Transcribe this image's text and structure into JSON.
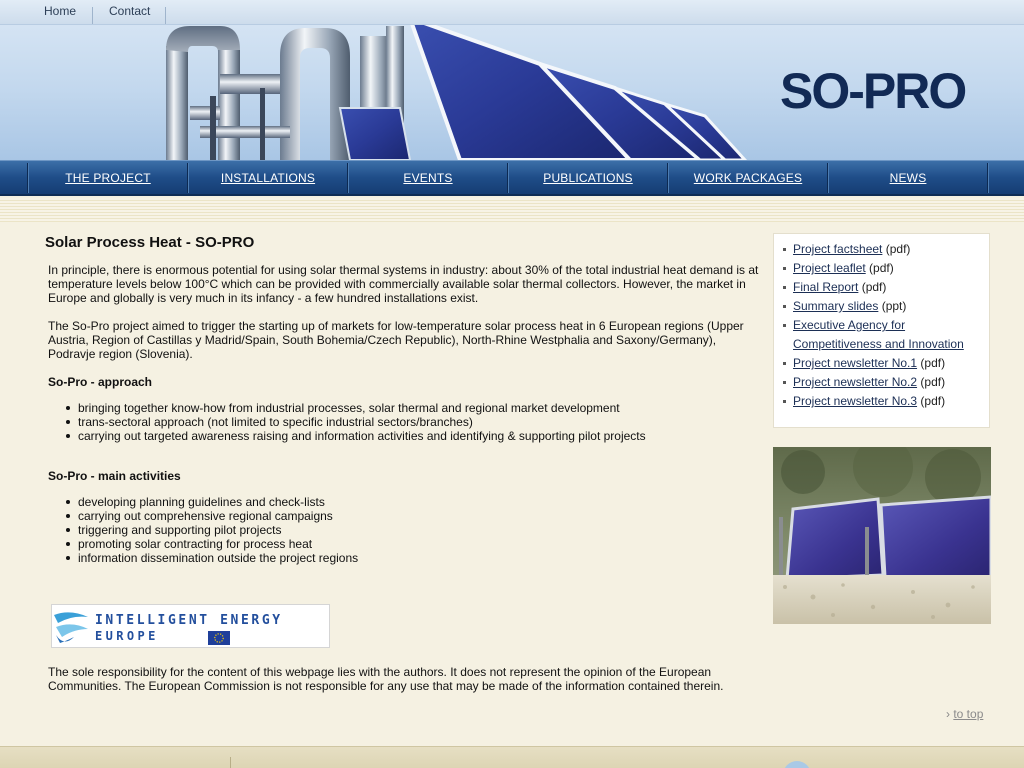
{
  "topnav": {
    "home": "Home",
    "contact": "Contact"
  },
  "logo": "SO-PRO",
  "mainnav": [
    {
      "label": "THE PROJECT"
    },
    {
      "label": "INSTALLATIONS"
    },
    {
      "label": "EVENTS"
    },
    {
      "label": "PUBLICATIONS"
    },
    {
      "label": "WORK PACKAGES"
    },
    {
      "label": "NEWS"
    }
  ],
  "content": {
    "title": "Solar Process Heat - SO-PRO",
    "p1": "In principle, there is enormous potential for using solar thermal systems in industry: about 30% of the total industrial heat demand is at temperature levels below 100°C which can be provided with commercially available solar thermal collectors. However, the market in Europe and globally is very much in its infancy - a few hundred installations exist.",
    "p2": "The So-Pro project aimed to trigger the starting up of markets for low-temperature solar process heat in 6 European regions (Upper Austria, Region of Castillas y Madrid/Spain, South Bohemia/Czech Republic), North-Rhine Westphalia and Saxony/Germany), Podravje region (Slovenia).",
    "approach_title": "So-Pro - approach",
    "approach": [
      "bringing together know-how from industrial processes, solar thermal and regional market development",
      "trans-sectoral approach (not limited to specific industrial sectors/branches)",
      "carrying out targeted awareness raising and information activities and identifying & supporting pilot projects"
    ],
    "activities_title": "So-Pro - main activities",
    "activities": [
      "developing planning guidelines and check-lists",
      "carrying out comprehensive regional campaigns",
      "triggering and supporting pilot projects",
      "promoting solar contracting for process heat",
      "information dissemination outside the project regions"
    ],
    "iee_line1": "INTELLIGENT ENERGY",
    "iee_line2": "EUROPE",
    "disclaimer": "The sole responsibility for the content of this webpage lies with the authors. It does not represent the opinion of the European Communities. The European Commission is not responsible for any use that may be made of the information contained therein.",
    "totop": "to top"
  },
  "sidebar": {
    "links": [
      {
        "link": "Project factsheet",
        "suffix": " (pdf)"
      },
      {
        "link": "Project leaflet",
        "suffix": " (pdf)"
      },
      {
        "link": "Final Report",
        "suffix": " (pdf)"
      },
      {
        "link": "Summary slides",
        "suffix": " (ppt)"
      },
      {
        "link": "Executive Agency for Competitiveness and Innovation",
        "suffix": ""
      },
      {
        "link": "Project newsletter No.1",
        "suffix": " (pdf)"
      },
      {
        "link": "Project newsletter No.2",
        "suffix": " (pdf)"
      },
      {
        "link": "Project newsletter No.3",
        "suffix": " (pdf)"
      }
    ]
  },
  "colors": {
    "nav_blue": "#1f4d88",
    "logo_navy": "#122a55",
    "page_bg": "#f5f1e2"
  }
}
